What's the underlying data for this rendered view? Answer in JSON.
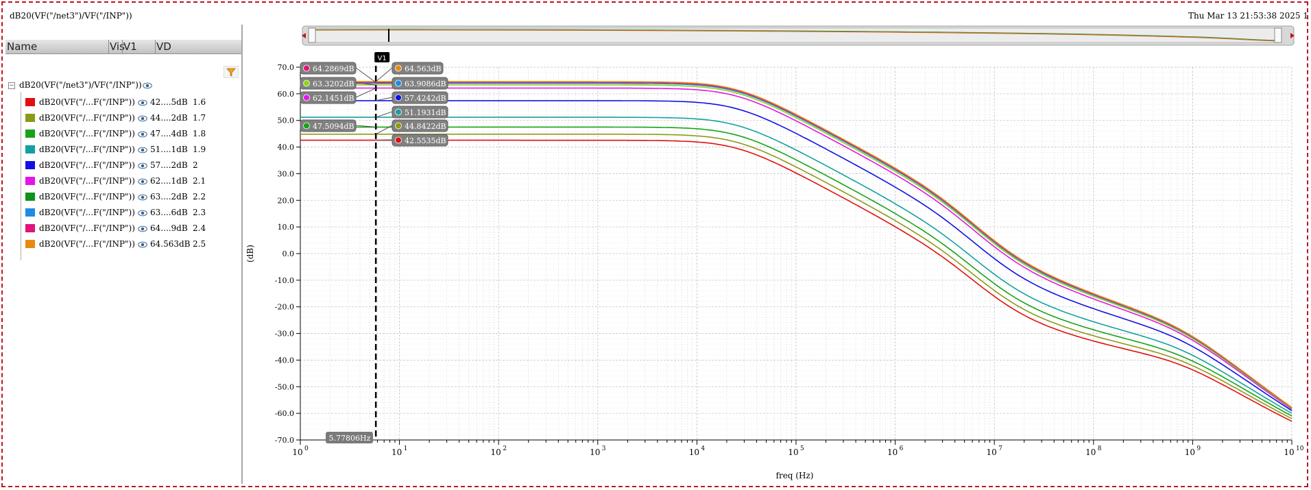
{
  "window": {
    "title": "dB20(VF(\"/net3\")/VF(\"/INP\"))",
    "datestamp": "Thu Mar 13 21:53:38 2025  1"
  },
  "legend": {
    "columns": [
      "Name",
      "Vis",
      "V1",
      "VD"
    ],
    "group_label": "dB20(VF(\"/net3\")/VF(\"/INP\"))",
    "rows": [
      {
        "name": "dB20(VF(\"/...F(\"/INP\"))",
        "v1": "42....5dB",
        "vd": "1.6",
        "color": "#e01010"
      },
      {
        "name": "dB20(VF(\"/...F(\"/INP\"))",
        "v1": "44....2dB",
        "vd": "1.7",
        "color": "#8c9a14"
      },
      {
        "name": "dB20(VF(\"/...F(\"/INP\"))",
        "v1": "47....4dB",
        "vd": "1.8",
        "color": "#16a316"
      },
      {
        "name": "dB20(VF(\"/...F(\"/INP\"))",
        "v1": "51....1dB",
        "vd": "1.9",
        "color": "#14a0a0"
      },
      {
        "name": "dB20(VF(\"/...F(\"/INP\"))",
        "v1": "57....2dB",
        "vd": "2",
        "color": "#1010e6"
      },
      {
        "name": "dB20(VF(\"/...F(\"/INP\"))",
        "v1": "62....1dB",
        "vd": "2.1",
        "color": "#e614e6"
      },
      {
        "name": "dB20(VF(\"/...F(\"/INP\"))",
        "v1": "63....2dB",
        "vd": "2.2",
        "color": "#10901c"
      },
      {
        "name": "dB20(VF(\"/...F(\"/INP\"))",
        "v1": "63....6dB",
        "vd": "2.3",
        "color": "#1e8ce6"
      },
      {
        "name": "dB20(VF(\"/...F(\"/INP\"))",
        "v1": "64....9dB",
        "vd": "2.4",
        "color": "#e0147a"
      },
      {
        "name": "dB20(VF(\"/...F(\"/INP\"))",
        "v1": "64.563dB",
        "vd": "2.5",
        "color": "#e88a10"
      }
    ]
  },
  "chart_data": {
    "type": "line",
    "xlabel": "freq (Hz)",
    "ylabel": "(dB)",
    "xscale": "log",
    "xlim": [
      1,
      10000000000
    ],
    "ylim": [
      -70,
      70
    ],
    "x_ticks": [
      "10",
      "10",
      "10",
      "10",
      "10",
      "10",
      "10",
      "10",
      "10",
      "10",
      "10"
    ],
    "x_tick_exponents": [
      "0",
      "1",
      "2",
      "3",
      "4",
      "5",
      "6",
      "7",
      "8",
      "9",
      "10"
    ],
    "y_ticks": [
      "70.0",
      "60.0",
      "50.0",
      "40.0",
      "30.0",
      "20.0",
      "10.0",
      "0.0",
      "-10.0",
      "-20.0",
      "-30.0",
      "-40.0",
      "-50.0",
      "-60.0",
      "-70.0"
    ],
    "grid": true,
    "cursor": {
      "name": "V1",
      "x": 5.77806,
      "x_label": "5.77806Hz"
    },
    "series": [
      {
        "color": "#e01010",
        "dc_gain": 42.5535,
        "label": "42.5535dB",
        "high_end": -63
      },
      {
        "color": "#8c9a14",
        "dc_gain": 44.8422,
        "label": "44.8422dB",
        "high_end": -62
      },
      {
        "color": "#16a316",
        "dc_gain": 47.5094,
        "label": "47.5094dB",
        "high_end": -61
      },
      {
        "color": "#14a0a0",
        "dc_gain": 51.1931,
        "label": "51.1931dB",
        "high_end": -60
      },
      {
        "color": "#1010e6",
        "dc_gain": 57.4242,
        "label": "57.4242dB",
        "high_end": -59
      },
      {
        "color": "#e614e6",
        "dc_gain": 62.1451,
        "label": "62.1451dB",
        "high_end": -58.5
      },
      {
        "color": "#8cd614",
        "dc_gain": 63.3202,
        "label": "63.3202dB",
        "high_end": -58.2
      },
      {
        "color": "#1e8ce6",
        "dc_gain": 63.9086,
        "label": "63.9086dB",
        "high_end": -58
      },
      {
        "color": "#e0147a",
        "dc_gain": 64.2869,
        "label": "64.2869dB",
        "high_end": -57.9
      },
      {
        "color": "#e88a10",
        "dc_gain": 64.563,
        "label": "64.563dB",
        "high_end": -57.8
      }
    ]
  }
}
